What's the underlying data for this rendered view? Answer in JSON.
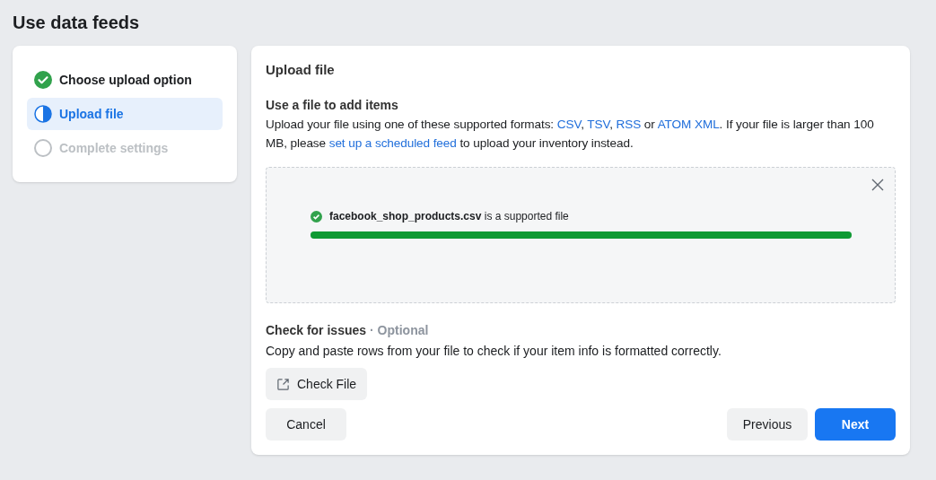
{
  "page_title": "Use data feeds",
  "steps": [
    {
      "label": "Choose upload option",
      "kind": "done",
      "selected": false
    },
    {
      "label": "Upload file",
      "kind": "current",
      "selected": true
    },
    {
      "label": "Complete settings",
      "kind": "todo",
      "selected": false
    }
  ],
  "panel": {
    "title": "Upload file",
    "section_title": "Use a file to add items",
    "description": [
      {
        "kind": "text",
        "text": "Upload your file using one of these supported formats: "
      },
      {
        "kind": "link",
        "text": "CSV"
      },
      {
        "kind": "text",
        "text": ", "
      },
      {
        "kind": "link",
        "text": "TSV"
      },
      {
        "kind": "text",
        "text": ", "
      },
      {
        "kind": "link",
        "text": "RSS"
      },
      {
        "kind": "text",
        "text": " or "
      },
      {
        "kind": "link",
        "text": "ATOM XML"
      },
      {
        "kind": "text",
        "text": ". If your file is larger than 100 MB, please "
      },
      {
        "kind": "link",
        "text": "set up a scheduled feed"
      },
      {
        "kind": "text",
        "text": " to upload your inventory instead."
      }
    ],
    "upload": {
      "message": "**facebook_shop_products.csv** is a supported file",
      "level": 1
    },
    "check_title": "Check for issues",
    "check_optional": "· Optional",
    "check_description": "Copy and paste rows from your file to check if your item info is formatted correctly.",
    "check_button": "Check File",
    "cancel": "Cancel",
    "previous": "Previous",
    "next": "Next"
  }
}
